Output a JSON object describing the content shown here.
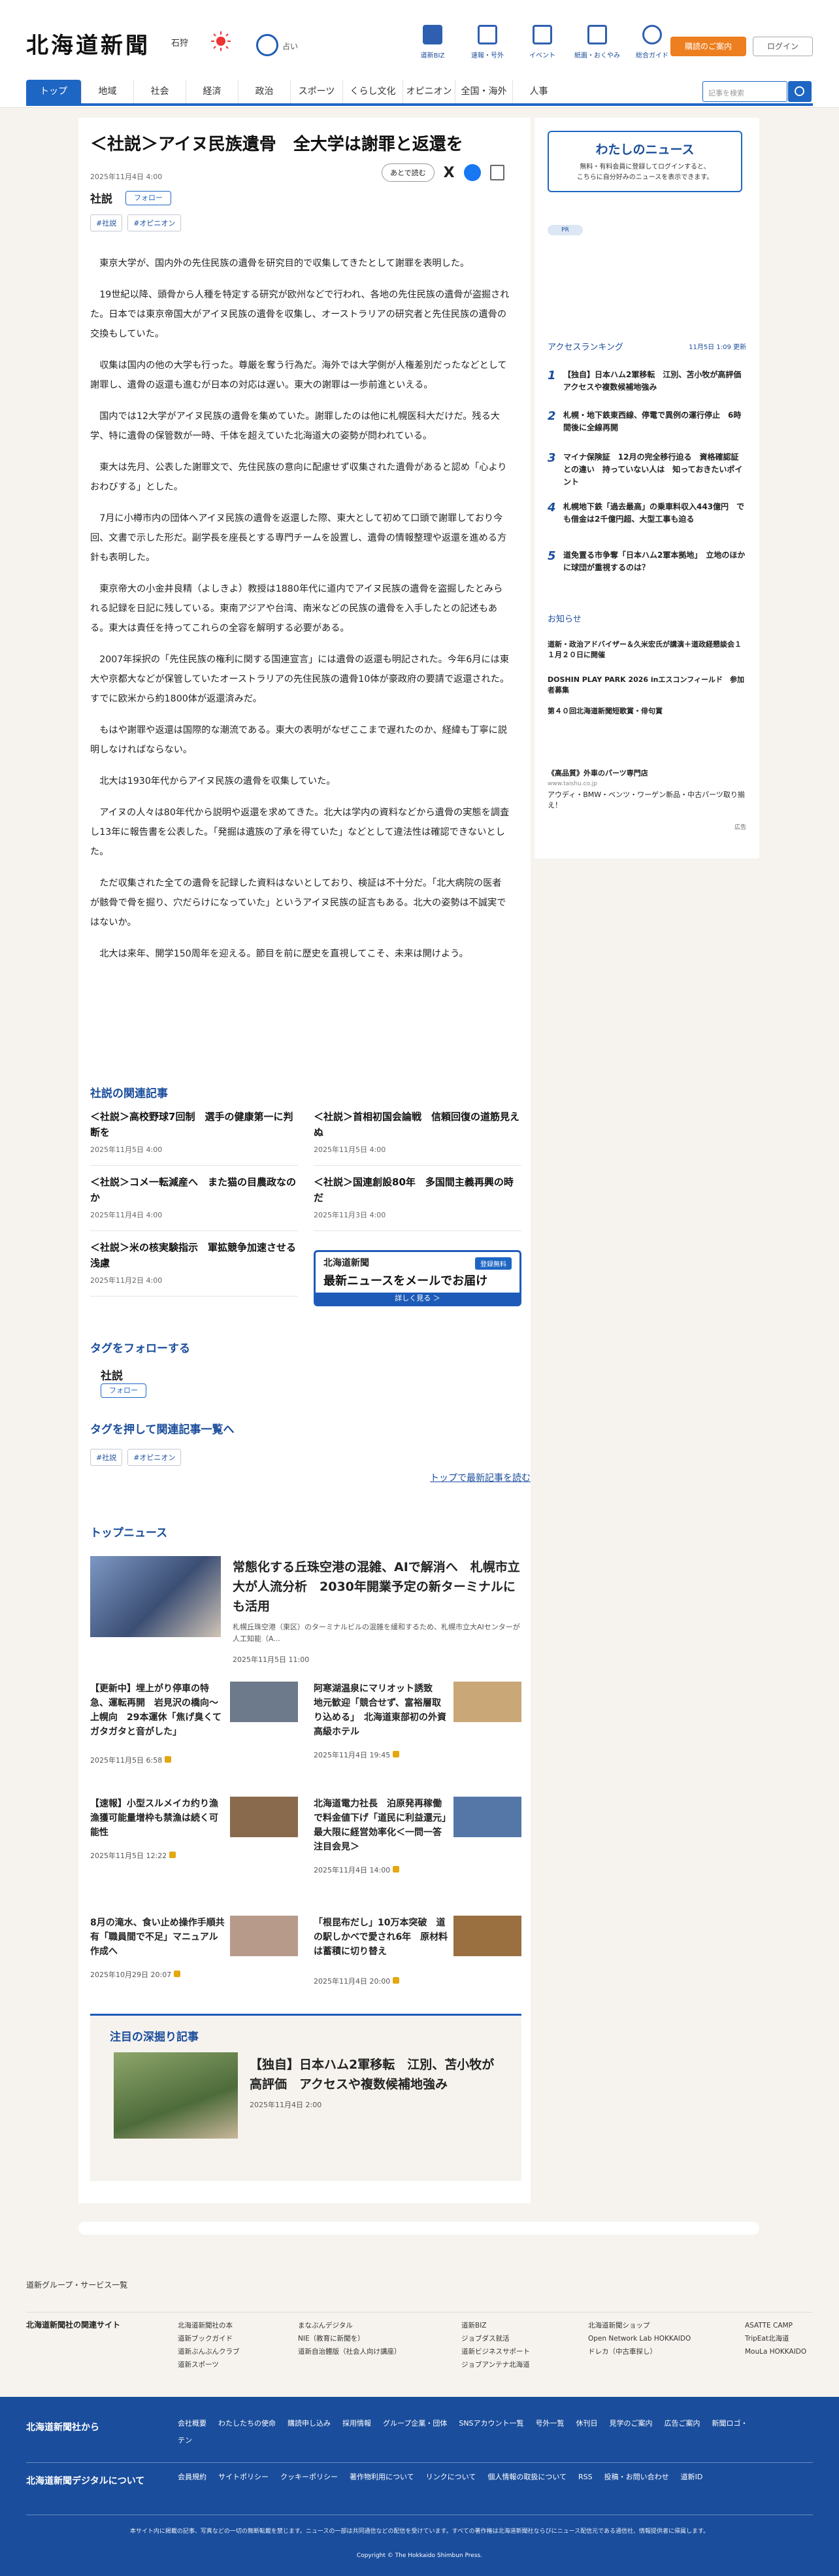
{
  "header": {
    "logo": "北海道新聞",
    "location": "石狩",
    "weather_label": "占い",
    "icons": [
      {
        "label": "道新BIZ",
        "name": "biz-icon"
      },
      {
        "label": "速報・号外",
        "name": "flag-icon"
      },
      {
        "label": "イベント",
        "name": "calendar-icon"
      },
      {
        "label": "紙面・おくやみ",
        "name": "paper-icon"
      },
      {
        "label": "総合ガイド",
        "name": "help-icon"
      }
    ],
    "newsletter_button": "購読のご案内",
    "login_button": "ログイン",
    "search_placeholder": "記事を検索"
  },
  "nav": [
    "トップ",
    "地域",
    "社会",
    "経済",
    "政治",
    "スポーツ",
    "くらし文化",
    "オピニオン",
    "全国・海外",
    "人事"
  ],
  "article": {
    "title": "＜社説＞アイヌ民族遺骨　全大学は謝罪と返還を",
    "date": "2025年11月4日 4:00",
    "category": "社説",
    "follow": "フォロー",
    "read_later": "あとで読む",
    "share_x": "X",
    "tags": [
      "#社説",
      "#オピニオン"
    ],
    "paragraphs": [
      "東京大学が、国内外の先住民族の遺骨を研究目的で収集してきたとして謝罪を表明した。",
      "19世紀以降、頭骨から人種を特定する研究が欧州などで行われ、各地の先住民族の遺骨が盗掘された。日本では東京帝国大がアイヌ民族の遺骨を収集し、オーストラリアの研究者と先住民族の遺骨の交換もしていた。",
      "収集は国内の他の大学も行った。尊厳を奪う行為だ。海外では大学側が人権差別だったなどとして謝罪し、遺骨の返還も進むが日本の対応は遅い。東大の謝罪は一歩前進といえる。",
      "国内では12大学がアイヌ民族の遺骨を集めていた。謝罪したのは他に札幌医科大だけだ。残る大学、特に遺骨の保管数が一時、千体を超えていた北海道大の姿勢が問われている。",
      "東大は先月、公表した謝罪文で、先住民族の意向に配慮せず収集された遺骨があると認め「心よりおわびする」とした。",
      "7月に小樽市内の団体へアイヌ民族の遺骨を返還した際、東大として初めて口頭で謝罪しており今回、文書で示した形だ。副学長を座長とする専門チームを設置し、遺骨の情報整理や返還を進める方針も表明した。",
      "東京帝大の小金井良精（よしきよ）教授は1880年代に道内でアイヌ民族の遺骨を盗掘したとみられる記録を日記に残している。東南アジアや台湾、南米などの民族の遺骨を入手したとの記述もある。東大は責任を持ってこれらの全容を解明する必要がある。",
      "2007年採択の「先住民族の権利に関する国連宣言」には遺骨の返還も明記された。今年6月には東大や京都大などが保管していたオーストラリアの先住民族の遺骨10体が豪政府の要請で返還された。すでに欧米から約1800体が返還済みだ。",
      "もはや謝罪や返還は国際的な潮流である。東大の表明がなぜここまで遅れたのか、経緯も丁寧に説明しなければならない。",
      "北大は1930年代からアイヌ民族の遺骨を収集していた。",
      "アイヌの人々は80年代から説明や返還を求めてきた。北大は学内の資料などから遺骨の実態を調査し13年に報告書を公表した。「発掘は遺族の了承を得ていた」などとして違法性は確認できないとした。",
      "ただ収集された全ての遺骨を記録した資料はないとしており、検証は不十分だ。「北大病院の医者が骸骨で骨を掘り、穴だらけになっていた」というアイヌ民族の証言もある。北大の姿勢は不誠実ではないか。",
      "北大は来年、開学150周年を迎える。節目を前に歴史を直視してこそ、未来は開けよう。"
    ]
  },
  "related": {
    "heading": "社説の関連記事",
    "items": [
      {
        "title": "＜社説＞高校野球7回制　選手の健康第一に判断を",
        "date": "2025年11月5日 4:00"
      },
      {
        "title": "＜社説＞首相初国会論戦　信頼回復の道筋見えぬ",
        "date": "2025年11月5日 4:00"
      },
      {
        "title": "＜社説＞コメ一転減産へ　また猫の目農政なのか",
        "date": "2025年11月4日 4:00"
      },
      {
        "title": "＜社説＞国連創設80年　多国間主義再興の時だ",
        "date": "2025年11月3日 4:00"
      },
      {
        "title": "＜社説＞米の核実験指示　軍拡競争加速させる浅慮",
        "date": "2025年11月2日 4:00"
      }
    ]
  },
  "mail_banner": {
    "logo": "北海道新聞",
    "badge": "登録無料",
    "headline": "最新ニュースをメールでお届け",
    "cta": "詳しく見る ＞"
  },
  "tag_follow": {
    "heading": "タグをフォローする",
    "tag": "社説",
    "follow": "フォロー"
  },
  "tag_list": {
    "heading": "タグを押して関連記事一覧へ",
    "tags": [
      "#社説",
      "#オピニオン"
    ],
    "top_link": "トップで最新記事を読む"
  },
  "top_news": {
    "heading": "トップニュース",
    "hero": {
      "title": "常態化する丘珠空港の混雑、AIで解消へ　札幌市立大が人流分析　2030年開業予定の新ターミナルにも活用",
      "summary": "札幌丘珠空港（東区）のターミナルビルの混雑を緩和するため、札幌市立大AIセンターが人工知能（A...",
      "date": "2025年11月5日 11:00"
    },
    "items": [
      {
        "title": "【更新中】埋上がり停車の特急、運転再開　岩見沢の橋向～上幌向　29本運休「焦げ臭くてガタガタと音がした」",
        "date": "2025年11月5日 6:58"
      },
      {
        "title": "阿寒湖温泉にマリオット誘致　地元歓迎「競合せず、富裕層取り込める」　北海道東部初の外資高級ホテル",
        "date": "2025年11月4日 19:45"
      },
      {
        "title": "【速報】小型スルメイカ约り漁　漁獲可能量增枠も禁漁は続く可能性",
        "date": "2025年11月5日 12:22"
      },
      {
        "title": "北海道電力社長　泊原発再稼働で料金値下げ「道民に利益還元」　最大限に経営効率化＜一問一答　注目会見＞",
        "date": "2025年11月4日 14:00"
      },
      {
        "title": "8月の滝水、食い止め操作手順共有「職員間で不足」マニュアル作成へ",
        "date": "2025年10月29日 20:07"
      },
      {
        "title": "「根昆布だし」10万本突破　道の駅しかべで愛され6年　原材料は蓄積に切り替え",
        "date": "2025年11月4日 20:00"
      }
    ]
  },
  "deep": {
    "heading": "注目の深掘り記事",
    "title": "【独自】日本ハム2軍移転　江別、苫小牧が高評価　アクセスや複数候補地強み",
    "date": "2025年11月4日 2:00"
  },
  "sidebar": {
    "my_news_title": "わたしのニュース",
    "my_news_desc1": "無料・有料会員に登録してログインすると、",
    "my_news_desc2": "こちらに自分好みのニュースを表示できます。",
    "pr": "PR",
    "ranking_heading": "アクセスランキング",
    "ranking_date": "11月5日 1:09 更新",
    "ranking": [
      "【独自】日本ハム2軍移転　江別、苫小牧が高評価　アクセスや複数候補地強み",
      "札幌・地下鉄東西線、停電で異例の運行停止　6時間後に全線再開",
      "マイナ保険証　12月の完全移行迫る　資格確認証との違い　持っていない人は　知っておきたいポイント",
      "札幌地下鉄「過去最高」の乗車料収入443億円　でも借金は2千億円超、大型工事も迫る",
      "道免置る市争奪「日本ハム2軍本拠地」　立地のほかに球団が重視するのは？"
    ],
    "notice_heading": "お知らせ",
    "notices": [
      "道新・政治アドバイザー＆久米宏氏が講演＋道政経懇談会１１月２０日に開催",
      "DOSHIN PLAY PARK 2026 inエスコンフィールド　参加者募集",
      "第４０回北海道新聞短歌賞・俳句賞"
    ],
    "ad_title": "《高品質》外車のパーツ専門店",
    "ad_url": "www.taishu.co.jp",
    "ad_text": "アウディ・BMW・ベンツ・ワーゲン新品・中古パーツ取り揃え！",
    "ad_label": "広告"
  },
  "footer": {
    "group": "道新グループ・サービス一覧",
    "related_heading": "北海道新聞社の関連サイト",
    "related_cols": [
      [
        "北海道新聞社の本",
        "道新ブックガイド",
        "道新ぶんぶんクラブ",
        "道新スポーツ"
      ],
      [
        "まなぶんデジタル",
        "NIE（教育に新聞を）",
        "道新自治體版（社会人向け講座）"
      ],
      [
        "道新BIZ",
        "ジョブダス就活",
        "道新ビジネスサポート",
        "ジョブアンテナ北海道"
      ],
      [
        "北海道新聞ショップ",
        "Open Network Lab HOKKAIDO",
        "ドレカ（中古車探し）"
      ],
      [
        "ASATTE CAMP",
        "TripEat北海道",
        "MouLa HOKKAIDO"
      ]
    ],
    "from_heading": "北海道新聞社から",
    "from_links": [
      "会社概要",
      "わたしたちの使命",
      "購読申し込み",
      "採用情報",
      "グループ企業・団体",
      "SNSアカウント一覧",
      "号外一覧",
      "休刊日",
      "見学のご案内",
      "広告ご案内",
      "新聞ロゴ・テン"
    ],
    "digital_heading": "北海道新聞デジタルについて",
    "digital_links": [
      "会員規約",
      "サイトポリシー",
      "クッキーポリシー",
      "著作物利用について",
      "リンクについて",
      "個人情報の取扱について",
      "RSS",
      "投稿・お問い合わせ",
      "道新ID"
    ],
    "note": "本サイト内に掲載の記事、写真などの一切の無断転載を禁じます。ニュースの一部は共同通信などの配信を受けています。すべての著作権は北海道新聞社ならびにニュース配信元である通信社、情報提供者に帰属します。",
    "copyright": "Copyright © The Hokkaido Shimbun Press."
  },
  "colors": {
    "brand_blue": "#1e66c4",
    "accent_orange": "#ee7f20",
    "footer_blue": "#1a4d9c"
  }
}
